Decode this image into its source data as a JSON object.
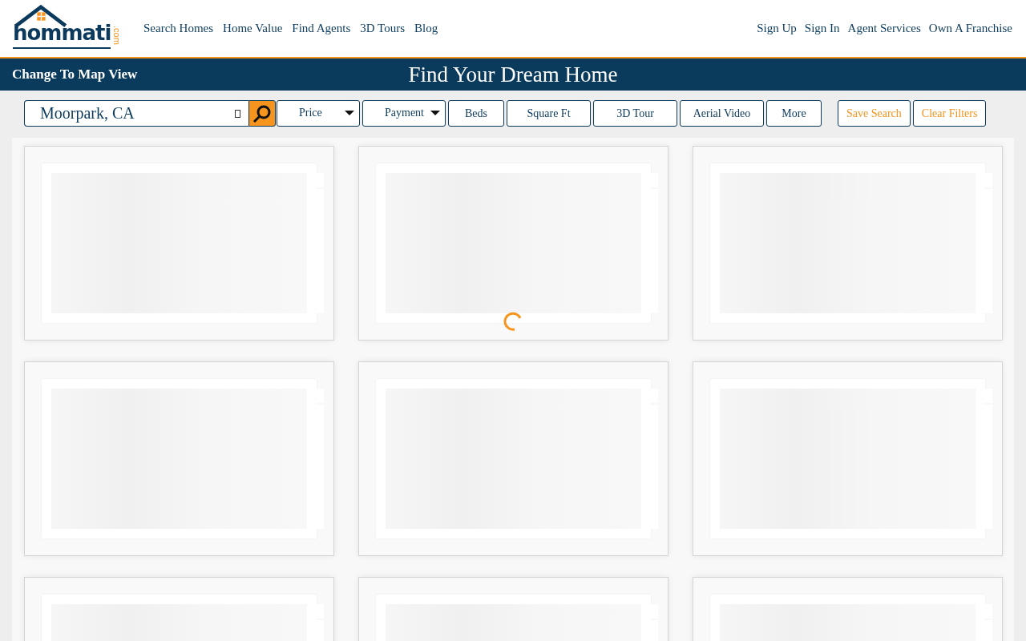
{
  "logo": {
    "name": "hommati",
    "suffix": ".com"
  },
  "nav_left": [
    "Search Homes",
    "Home Value",
    "Find Agents",
    "3D Tours",
    "Blog"
  ],
  "nav_right": [
    "Sign Up",
    "Sign In",
    "Agent Services",
    "Own A Franchise"
  ],
  "banner": {
    "map_view_link": "Change To Map View",
    "title": "Find Your Dream Home"
  },
  "search": {
    "value": "Moorpark, CA"
  },
  "filters": [
    {
      "label": "Price",
      "kind": "dropdown"
    },
    {
      "label": "Payment",
      "kind": "dropdown"
    },
    {
      "label": "Beds",
      "kind": "button"
    },
    {
      "label": "Square Ft",
      "kind": "button"
    },
    {
      "label": "3D Tour",
      "kind": "button"
    },
    {
      "label": "Aerial Video",
      "kind": "button"
    },
    {
      "label": "More",
      "kind": "button"
    }
  ],
  "actions": [
    "Save Search",
    "Clear Filters"
  ],
  "listings": {
    "loading": true,
    "cards": [
      {
        "kind": "placeholder"
      },
      {
        "kind": "placeholder"
      },
      {
        "kind": "placeholder"
      },
      {
        "kind": "placeholder"
      },
      {
        "kind": "placeholder"
      },
      {
        "kind": "placeholder"
      },
      {
        "kind": "placeholder"
      },
      {
        "kind": "placeholder"
      },
      {
        "kind": "placeholder"
      }
    ]
  }
}
